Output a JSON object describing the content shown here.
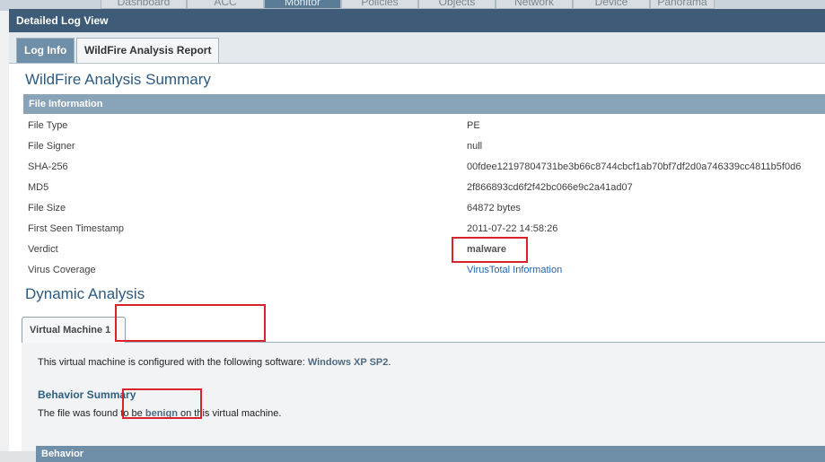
{
  "background_nav": {
    "tabs": [
      "Dashboard",
      "ACC",
      "Monitor",
      "Policies",
      "Objects",
      "Network",
      "Device",
      "Panorama"
    ],
    "active_tab": "Monitor"
  },
  "dialog": {
    "title": "Detailed Log View",
    "tabs": [
      {
        "label": "Log Info",
        "active": false
      },
      {
        "label": "WildFire Analysis Report",
        "active": true
      }
    ]
  },
  "summary": {
    "heading": "WildFire Analysis Summary",
    "section_title": "File Information",
    "fields": [
      {
        "key": "File Type",
        "value": "PE"
      },
      {
        "key": "File Signer",
        "value": "null"
      },
      {
        "key": "SHA-256",
        "value": "00fdee12197804731be3b66c8744cbcf1ab70bf7df2d0a746339cc4811b5f0d6"
      },
      {
        "key": "MD5",
        "value": "2f866893cd6f2f42bc066e9c2a41ad07"
      },
      {
        "key": "File Size",
        "value": "64872 bytes"
      },
      {
        "key": "First Seen Timestamp",
        "value": "2011-07-22 14:58:26"
      },
      {
        "key": "Verdict",
        "value": "malware"
      },
      {
        "key": "Virus Coverage",
        "value": "VirusTotal Information"
      }
    ]
  },
  "dynamic": {
    "heading": "Dynamic Analysis",
    "vm_tab": "Virtual Machine 1",
    "config_prefix": "This virtual machine is configured with the following software: ",
    "config_software": "Windows XP SP2",
    "config_suffix": ".",
    "behavior_title": "Behavior Summary",
    "behavior_prefix": "The file was found to be ",
    "behavior_verdict": "benign",
    "behavior_suffix": " on this virtual machine.",
    "behavior_table_head": "Behavior"
  },
  "colors": {
    "highlight_box": "#d9232a",
    "title_bar": "#3e5c77",
    "section_header": "#89a4b8"
  }
}
